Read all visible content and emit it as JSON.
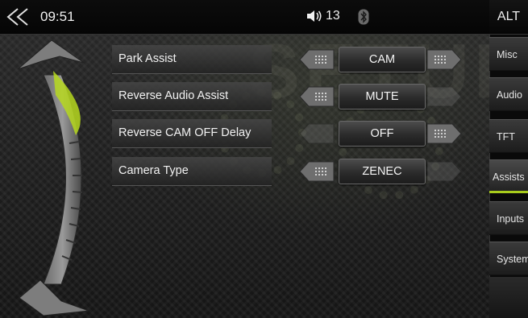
{
  "status_bar": {
    "time": "09:51",
    "volume_level": "13",
    "icons": [
      "back-chevron-icon",
      "speaker-icon",
      "bluetooth-icon"
    ]
  },
  "watermark": "SETUP",
  "settings": [
    {
      "label": "Park Assist",
      "value": "CAM"
    },
    {
      "label": "Reverse Audio Assist",
      "value": "MUTE"
    },
    {
      "label": "Reverse CAM OFF Delay",
      "value": "OFF"
    },
    {
      "label": "Camera Type",
      "value": "ZENEC"
    }
  ],
  "side_menu": {
    "top_label": "ALT",
    "items": [
      "Misc",
      "Audio",
      "TFT",
      "Assists",
      "Inputs",
      "System"
    ],
    "active": "Assists"
  },
  "colors": {
    "accent": "#a8cc1c"
  }
}
